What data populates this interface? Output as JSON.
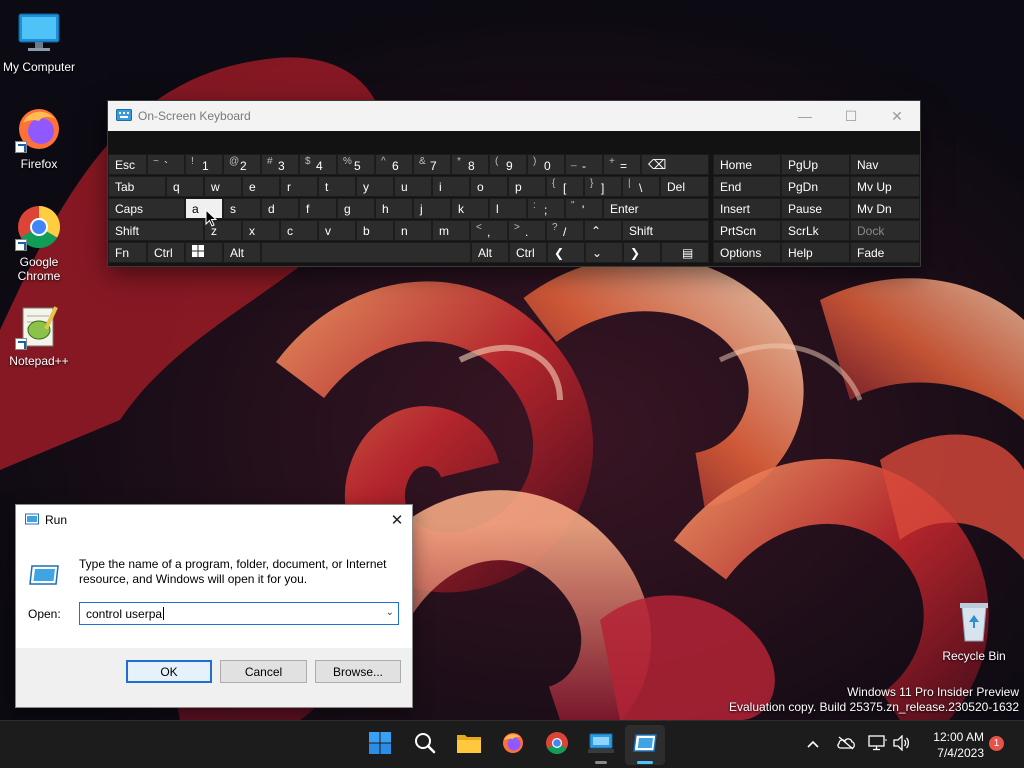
{
  "desktop": {
    "icons": [
      {
        "label": "My Computer",
        "icon": "computer-icon"
      },
      {
        "label": "Firefox",
        "icon": "firefox-icon"
      },
      {
        "label": "Google Chrome",
        "icon": "chrome-icon"
      },
      {
        "label": "Notepad++",
        "icon": "notepad-plus-plus-icon"
      },
      {
        "label": "Recycle Bin",
        "icon": "recycle-bin-icon"
      }
    ]
  },
  "osk": {
    "title": "On-Screen Keyboard",
    "row1": [
      "Esc",
      "~ `",
      "! 1",
      "@ 2",
      "# 3",
      "$ 4",
      "% 5",
      "^ 6",
      "& 7",
      "* 8",
      "( 9",
      ") 0",
      "_ -",
      "+ ="
    ],
    "row1_pairs": [
      [
        "~",
        "`"
      ],
      [
        "!",
        "1"
      ],
      [
        "@",
        "2"
      ],
      [
        "#",
        "3"
      ],
      [
        "$",
        "4"
      ],
      [
        "%",
        "5"
      ],
      [
        "^",
        "6"
      ],
      [
        "&",
        "7"
      ],
      [
        "*",
        "8"
      ],
      [
        "(",
        "9"
      ],
      [
        ")",
        "0"
      ],
      [
        "_",
        "-"
      ],
      [
        "+",
        "="
      ]
    ],
    "row2": [
      "Tab",
      "q",
      "w",
      "e",
      "r",
      "t",
      "y",
      "u",
      "i",
      "o",
      "p"
    ],
    "row2_pairs": [
      [
        "{",
        "["
      ],
      [
        "}",
        "]"
      ],
      [
        "|",
        "\\"
      ]
    ],
    "row2_end": "Del",
    "row3": [
      "Caps",
      "a",
      "s",
      "d",
      "f",
      "g",
      "h",
      "j",
      "k",
      "l"
    ],
    "row3_pairs": [
      [
        ":",
        ";"
      ],
      [
        "\"",
        "'"
      ]
    ],
    "row3_end": "Enter",
    "row4": [
      "Shift",
      "z",
      "x",
      "c",
      "v",
      "b",
      "n",
      "m"
    ],
    "row4_pairs": [
      [
        "<",
        ","
      ],
      [
        ">",
        "."
      ],
      [
        "?",
        "/"
      ]
    ],
    "row4_end": "Shift",
    "row5": {
      "fn": "Fn",
      "ctrl": "Ctrl",
      "alt": "Alt",
      "alt_right": "Alt",
      "ctrl_right": "Ctrl"
    },
    "nav_keys": [
      [
        "Home",
        "PgUp",
        "Nav"
      ],
      [
        "End",
        "PgDn",
        "Mv Up"
      ],
      [
        "Insert",
        "Pause",
        "Mv Dn"
      ],
      [
        "PrtScn",
        "ScrLk",
        "Dock"
      ],
      [
        "Options",
        "Help",
        "Fade"
      ]
    ],
    "pressed_key": "a"
  },
  "run": {
    "title": "Run",
    "description": "Type the name of a program, folder, document, or Internet resource, and Windows will open it for you.",
    "open_label": "Open:",
    "input_value": "control userpa",
    "ok": "OK",
    "cancel": "Cancel",
    "browse": "Browse..."
  },
  "watermark": {
    "line1": "Windows 11 Pro Insider Preview",
    "line2": "Evaluation copy. Build 25375.zn_release.230520-1632"
  },
  "taskbar": {
    "items": [
      "start-icon",
      "search-icon",
      "file-explorer-icon",
      "firefox-icon",
      "chrome-icon",
      "osk-icon",
      "run-icon"
    ],
    "time": "12:00 AM",
    "date": "7/4/2023",
    "notification_count": "1"
  }
}
